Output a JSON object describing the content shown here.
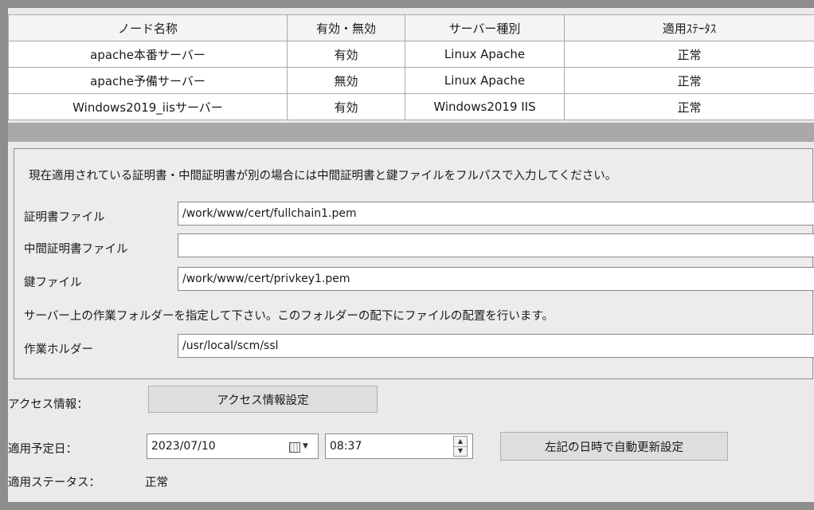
{
  "node_table": {
    "headers": [
      "ノード名称",
      "有効・無効",
      "サーバー種別",
      "適用ｽﾃｰﾀｽ"
    ],
    "rows": [
      [
        "apache本番サーバー",
        "有効",
        "Linux Apache",
        "正常"
      ],
      [
        "apache予備サーバー",
        "無効",
        "Linux Apache",
        "正常"
      ],
      [
        "Windows2019_iisサーバー",
        "有効",
        "Windows2019 IIS",
        "正常"
      ]
    ]
  },
  "cert": {
    "note": "現在適用されている証明書・中間証明書が別の場合には中間証明書と鍵ファイルをフルパスで入力してください。",
    "cert_file_label": "証明書ファイル",
    "cert_file_value": "/work/www/cert/fullchain1.pem",
    "intermediate_label": "中間証明書ファイル",
    "intermediate_value": "",
    "key_file_label": "鍵ファイル",
    "key_file_value": "/work/www/cert/privkey1.pem",
    "work_note": "サーバー上の作業フォルダーを指定して下さい。このフォルダーの配下にファイルの配置を行います。",
    "work_folder_label": "作業ホルダー",
    "work_folder_value": "/usr/local/scm/ssl"
  },
  "access": {
    "label": "アクセス情報：",
    "button": "アクセス情報設定"
  },
  "schedule": {
    "date_label": "適用予定日：",
    "date_value": "2023/07/10",
    "time_value": "08:37",
    "auto_button": "左記の日時で自動更新設定"
  },
  "status": {
    "label": "適用ステータス：",
    "value": "正常"
  }
}
